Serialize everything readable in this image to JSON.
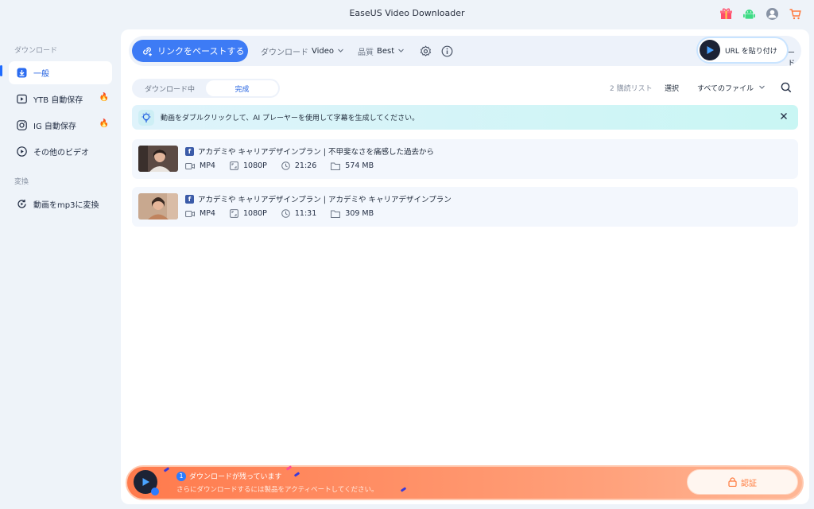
{
  "app": {
    "title": "EaseUS Video Downloader"
  },
  "title_icons": [
    "gift-icon",
    "android-icon",
    "account-icon",
    "cart-icon"
  ],
  "sidebar": {
    "sections": [
      {
        "label": "ダウンロード",
        "items": [
          {
            "label": "一般",
            "icon": "download-icon",
            "active": true
          },
          {
            "label": "YTB 自動保存",
            "icon": "play-icon",
            "hot": true
          },
          {
            "label": "IG 自動保存",
            "icon": "instagram-icon",
            "hot": true
          },
          {
            "label": "その他のビデオ",
            "icon": "play-circle-icon"
          }
        ]
      },
      {
        "label": "変換",
        "items": [
          {
            "label": "動画をmp3に変換",
            "icon": "convert-icon"
          }
        ]
      }
    ]
  },
  "toolbar": {
    "paste_label": "リンクをペーストする",
    "download_label": "ダウンロード",
    "download_value": "Video",
    "quality_label": "品質",
    "quality_value": "Best",
    "url_pill_label": "URL を貼り付け",
    "url_pill_tail": "ード"
  },
  "tabs": {
    "downloading": "ダウンロード中",
    "completed": "完成",
    "active": "completed"
  },
  "list_controls": {
    "watch_list": "2 購読リスト",
    "select": "選択",
    "filter": "すべてのファイル"
  },
  "banner": {
    "text": "動画をダブルクリックして、AI プレーヤーを使用して字幕を生成してください。"
  },
  "items": [
    {
      "title": "アカデミや キャリアデザインプラン | 不甲斐なさを痛感した過去から",
      "format": "MP4",
      "resolution": "1080P",
      "duration": "21:26",
      "size": "574 MB"
    },
    {
      "title": "アカデミや キャリアデザインプラン | アカデミや キャリアデザインプラン",
      "format": "MP4",
      "resolution": "1080P",
      "duration": "11:31",
      "size": "309 MB"
    }
  ],
  "bottom": {
    "count": "1",
    "remaining": "ダウンロードが残っています",
    "hint": "さらにダウンロードするには製品をアクティベートしてください。",
    "activate": "認証"
  },
  "colors": {
    "accent": "#3d7bf5",
    "banner": "#c9f6f4",
    "bottom_bar": "#ff7a4c"
  }
}
